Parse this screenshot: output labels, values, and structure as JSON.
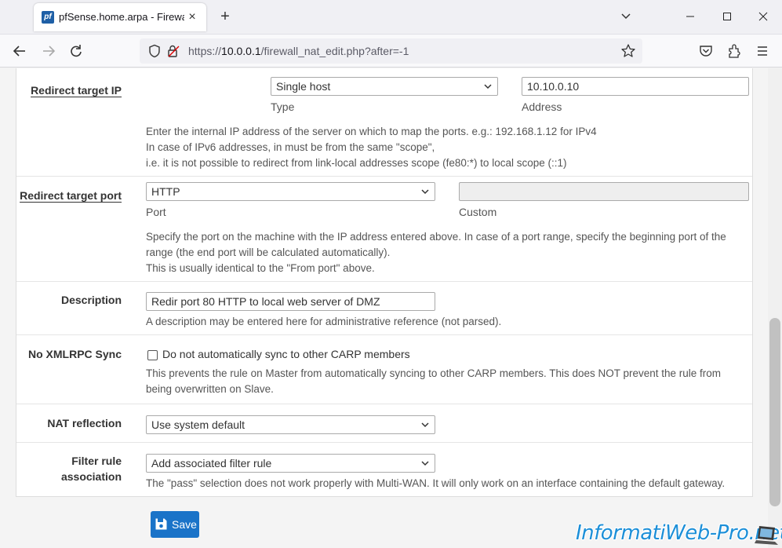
{
  "browser": {
    "tab_title": "pfSense.home.arpa - Firewall: N",
    "favicon_text": "pf",
    "url_prefix": "https://",
    "url_host": "10.0.0.1",
    "url_path": "/firewall_nat_edit.php?after=-1"
  },
  "form": {
    "redirect_ip": {
      "label": "Redirect target IP",
      "type_value": "Single host",
      "type_sublabel": "Type",
      "address_value": "10.10.0.10",
      "address_sublabel": "Address",
      "help_line1": "Enter the internal IP address of the server on which to map the ports. e.g.: 192.168.1.12 for IPv4",
      "help_line2": "In case of IPv6 addresses, in must be from the same \"scope\",",
      "help_line3": "i.e. it is not possible to redirect from link-local addresses scope (fe80:*) to local scope (::1)"
    },
    "redirect_port": {
      "label": "Redirect target port",
      "port_value": "HTTP",
      "port_sublabel": "Port",
      "custom_value": "",
      "custom_sublabel": "Custom",
      "help_line1": "Specify the port on the machine with the IP address entered above. In case of a port range, specify the beginning port of the",
      "help_line2": "range (the end port will be calculated automatically).",
      "help_line3": "This is usually identical to the \"From port\" above."
    },
    "description": {
      "label": "Description",
      "value": "Redir port 80 HTTP to local web server of DMZ",
      "help": "A description may be entered here for administrative reference (not parsed)."
    },
    "xmlrpc": {
      "label": "No XMLRPC Sync",
      "checkbox_label": "Do not automatically sync to other CARP members",
      "checked": false,
      "help_line1": "This prevents the rule on Master from automatically syncing to other CARP members. This does NOT prevent the rule from",
      "help_line2": "being overwritten on Slave."
    },
    "nat_reflection": {
      "label": "NAT reflection",
      "value": "Use system default"
    },
    "filter_rule": {
      "label_line1": "Filter rule",
      "label_line2": "association",
      "value": "Add associated filter rule",
      "help": "The \"pass\" selection does not work properly with Multi-WAN. It will only work on an interface containing the default gateway."
    },
    "save_label": "Save"
  },
  "watermark": "InformatiWeb-Pro.net",
  "colors": {
    "save_button": "#1a73c8",
    "watermark": "#1c8fd8"
  }
}
